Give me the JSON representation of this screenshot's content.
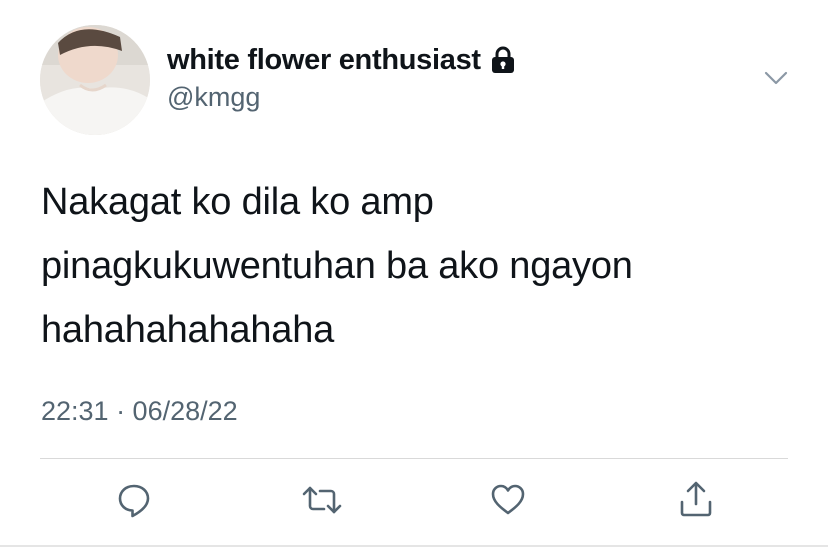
{
  "tweet": {
    "display_name": "white flower enthusiast",
    "handle": "@kmgg",
    "protected_icon": "lock-icon",
    "text_lines": [
      "Nakagat ko dila ko amp",
      "pinagkukuwentuhan ba ako ngayon",
      "hahahahahahaha"
    ],
    "timestamp": "22:31 · 06/28/22"
  },
  "actions": {
    "reply_icon": "reply-icon",
    "retweet_icon": "retweet-icon",
    "like_icon": "heart-icon",
    "share_icon": "share-icon"
  },
  "colors": {
    "text_primary": "#0f1419",
    "text_secondary": "#536471",
    "divider": "#d9d9d9",
    "icon": "#536471"
  }
}
